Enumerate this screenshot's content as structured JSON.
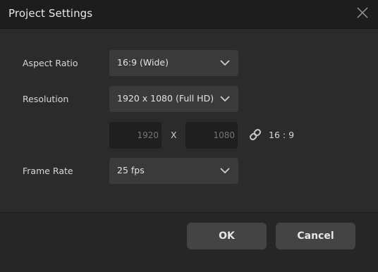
{
  "window": {
    "title": "Project Settings"
  },
  "fields": {
    "aspect_ratio": {
      "label": "Aspect Ratio",
      "value": "16:9 (Wide)"
    },
    "resolution": {
      "label": "Resolution",
      "value": "1920 x 1080 (Full HD)",
      "width_placeholder": "1920",
      "height_placeholder": "1080",
      "separator": "X",
      "ratio_text": "16 : 9",
      "link_icon": "link-chain-icon"
    },
    "frame_rate": {
      "label": "Frame Rate",
      "value": "25 fps"
    }
  },
  "buttons": {
    "ok": "OK",
    "cancel": "Cancel"
  },
  "colors": {
    "background": "#2b2b2b",
    "titlebar": "#1d1d1d",
    "select_bg": "#3a3a3a",
    "input_bg": "#1f1f1f",
    "button_bg": "#444444"
  }
}
